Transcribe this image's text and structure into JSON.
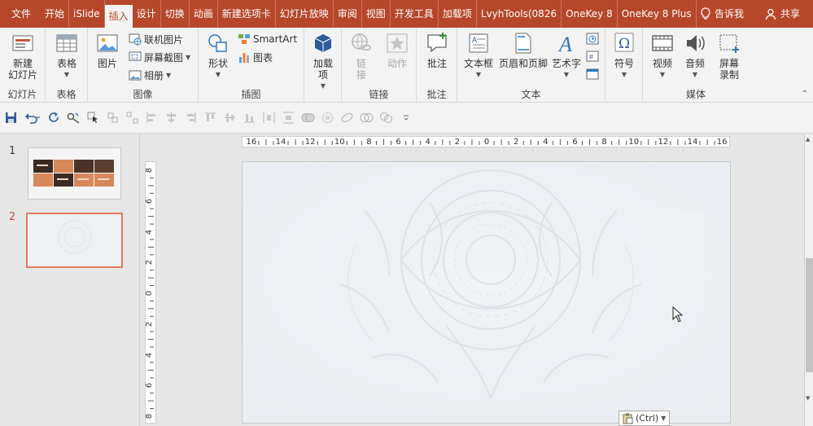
{
  "tabs": [
    "文件",
    "开始",
    "iSlide",
    "插入",
    "设计",
    "切换",
    "动画",
    "新建选项卡",
    "幻灯片放映",
    "审阅",
    "视图",
    "开发工具",
    "加载项",
    "LvyhTools(0826",
    "OneKey 8",
    "OneKey 8 Plus"
  ],
  "active_tab": "插入",
  "tell_me": "告诉我",
  "share": "共享",
  "ribbon": {
    "slides": {
      "label": "幻灯片",
      "new_slide": "新建\n幻灯片"
    },
    "tables": {
      "label": "表格",
      "table": "表格"
    },
    "images": {
      "label": "图像",
      "picture": "图片",
      "online_picture": "联机图片",
      "screenshot": "屏幕截图",
      "album": "相册"
    },
    "illustrations": {
      "label": "插图",
      "shapes": "形状",
      "smartart": "SmartArt",
      "chart": "图表"
    },
    "addins": {
      "label": "",
      "addin": "加载\n项"
    },
    "links": {
      "label": "链接",
      "link": "链\n接",
      "action": "动作"
    },
    "comments": {
      "label": "批注",
      "comment": "批注"
    },
    "text": {
      "label": "文本",
      "textbox": "文本框",
      "header_footer": "页眉和页脚",
      "wordart": "艺术字"
    },
    "symbols": {
      "label": "",
      "symbol": "符号"
    },
    "media": {
      "label": "媒体",
      "video": "视频",
      "audio": "音频",
      "screen_record": "屏幕\n录制"
    }
  },
  "slides": [
    {
      "num": "1"
    },
    {
      "num": "2"
    }
  ],
  "hruler_labels": [
    "16",
    "14",
    "12",
    "10",
    "8",
    "6",
    "4",
    "2",
    "0",
    "2",
    "4",
    "6",
    "8",
    "10",
    "12",
    "14",
    "16"
  ],
  "vruler_labels": [
    "8",
    "6",
    "4",
    "2",
    "0",
    "2",
    "4",
    "6",
    "8"
  ],
  "paste_options": "(Ctrl)",
  "colors": {
    "accent": "#b7472a",
    "ribbon_bg": "#f3f3f3",
    "active_thumb_border": "#e07a5f"
  }
}
